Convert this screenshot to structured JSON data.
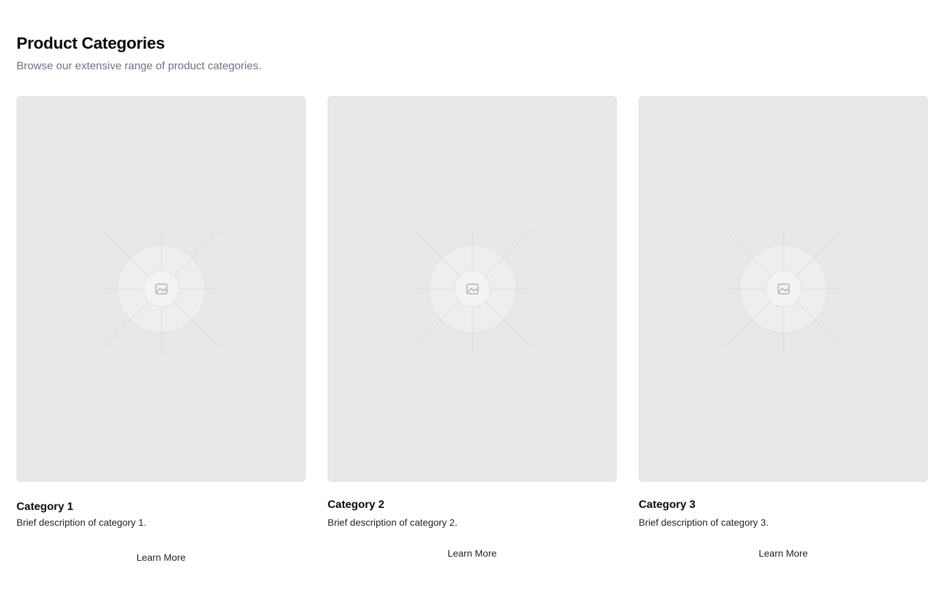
{
  "header": {
    "title": "Product Categories",
    "subtitle": "Browse our extensive range of product categories."
  },
  "categories": [
    {
      "title": "Category 1",
      "description": "Brief description of category 1.",
      "button_label": "Learn More",
      "image_icon": "image-placeholder-icon"
    },
    {
      "title": "Category 2",
      "description": "Brief description of category 2.",
      "button_label": "Learn More",
      "image_icon": "image-placeholder-icon"
    },
    {
      "title": "Category 3",
      "description": "Brief description of category 3.",
      "button_label": "Learn More",
      "image_icon": "image-placeholder-icon"
    }
  ],
  "colors": {
    "background": "#ffffff",
    "placeholder": "#e8e8e8",
    "subtitle": "#6b7280",
    "text": "#0a0a0a"
  }
}
